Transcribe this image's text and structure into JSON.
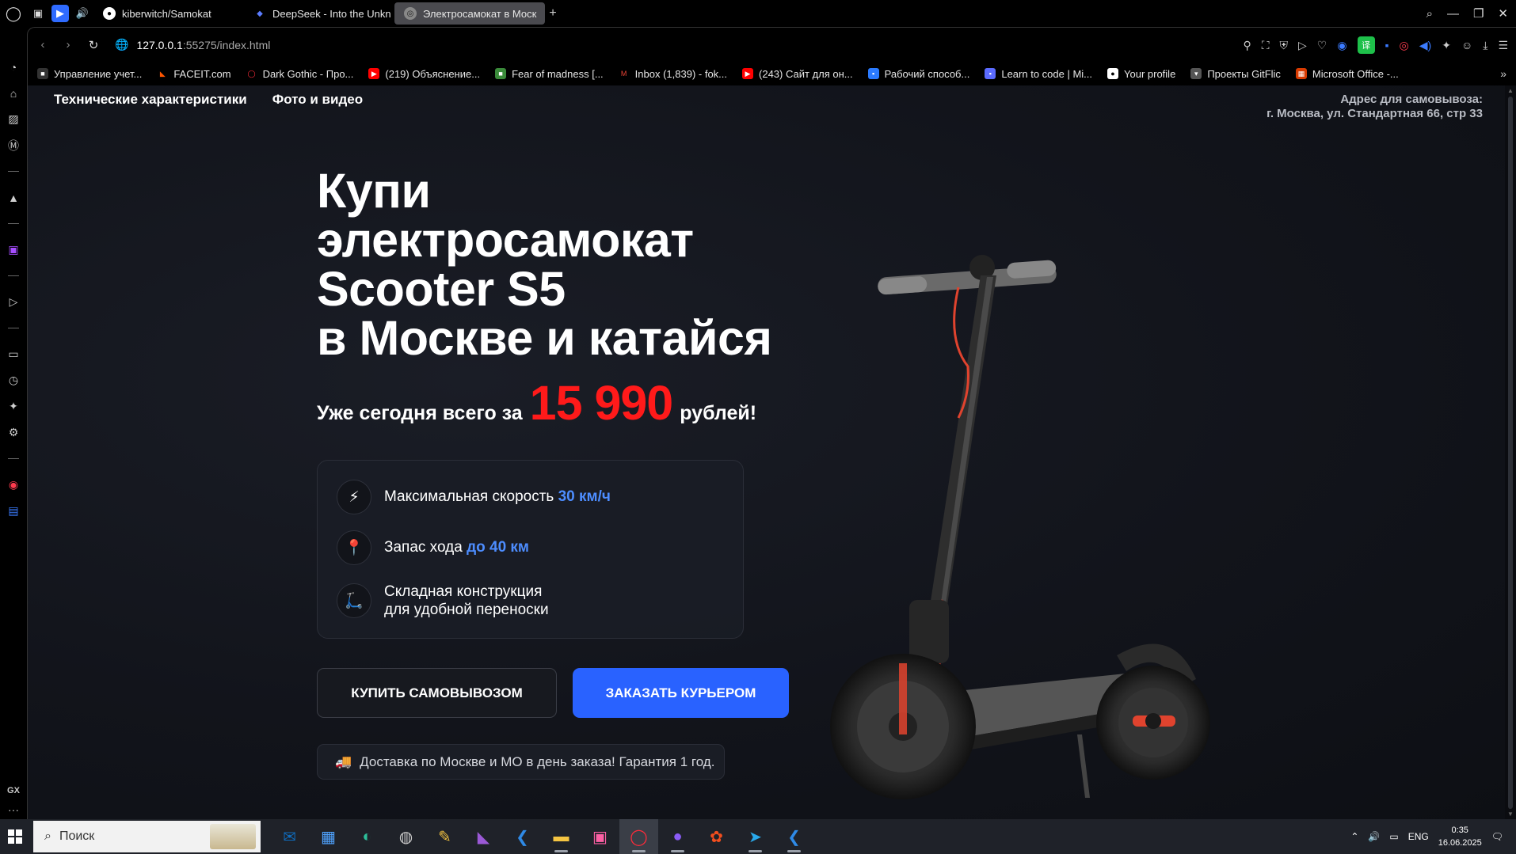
{
  "browser": {
    "tabs": [
      {
        "label": "kiberwitch/Samokat",
        "icon": "github-icon"
      },
      {
        "label": "DeepSeek - Into the Unkn",
        "icon": "deepseek-icon"
      },
      {
        "label": "Электросамокат в Моск",
        "icon": "globe-icon"
      }
    ],
    "url_host": "127.0.0.1",
    "url_path": ":55275/index.html",
    "bookmarks": [
      "Управление учет...",
      "FACEIT.com",
      "Dark Gothic - Про...",
      "(219) Объяснение...",
      "Fear of madness [...",
      "Inbox (1,839) - fok...",
      "(243) Сайт для он...",
      "Рабочий способ...",
      "Learn to code | Mi...",
      "Your profile",
      "Проекты GitFlic",
      "Microsoft Office -..."
    ],
    "gx_label": "GX"
  },
  "site": {
    "nav": [
      "Технические характеристики",
      "Фото и видео"
    ],
    "pickup_label": "Адрес для самовывоза:",
    "pickup_address": "г. Москва, ул. Стандартная 66, стр 33",
    "hero_lines": [
      "Купи",
      "электросамокат",
      "Scooter S5",
      "в Москве и катайся"
    ],
    "price_prefix": "Уже сегодня всего за",
    "price_amount": "15 990",
    "price_suffix": "рублей!",
    "features": [
      {
        "icon": "⚡",
        "text": "Максимальная скорость",
        "accent": "30 км/ч"
      },
      {
        "icon": "📍",
        "text": "Запас хода",
        "accent": "до 40 км"
      },
      {
        "icon": "🛴",
        "line1": "Складная конструкция",
        "line2": "для удобной переноски"
      }
    ],
    "btn_pickup": "КУПИТЬ САМОВЫВОЗОМ",
    "btn_courier": "ЗАКАЗАТЬ КУРЬЕРОМ",
    "delivery_icon": "🚚",
    "delivery_text": "Доставка по Москве и МО в день заказа! Гарантия 1 год."
  },
  "taskbar": {
    "search_placeholder": "Поиск",
    "lang": "ENG",
    "time": "0:35",
    "date": "16.06.2025"
  },
  "colors": {
    "accent_blue": "#2962ff",
    "price_red": "#ff1a1a",
    "feature_accent": "#4d8dff"
  }
}
